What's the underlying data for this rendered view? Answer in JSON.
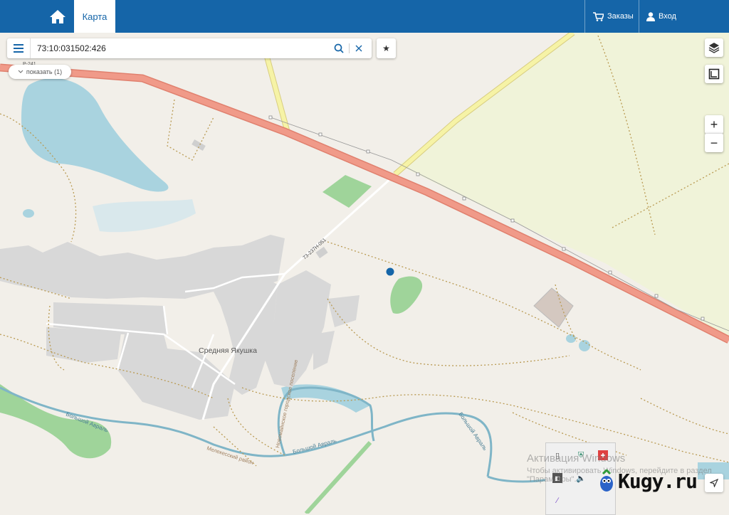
{
  "header": {
    "tab_label": "Карта",
    "orders_label": "Заказы",
    "login_label": "Вход"
  },
  "search": {
    "value": "73:10:031502:426"
  },
  "filter_chip": {
    "label": "показать (1)"
  },
  "map": {
    "settlement_label": "Средняя Якушка",
    "road_label_main": "Р-241",
    "road_label_local": "73-237Н-051",
    "river_label_1": "Большой Авраль",
    "river_label_2": "Большой Авраль",
    "river_label_3": "Большой Авраль",
    "district_label": "Мелекесский район",
    "settlement_boundary_label": "Новомайнское городское поселение",
    "colors": {
      "background": "#f2efe9",
      "motorway": "#f09a89",
      "secondary_road": "#f6f3a6",
      "water": "#a9d3df",
      "field": "#f0f3d9",
      "forest": "#9fd49a",
      "industrial": "#d8d8d8",
      "boundary": "#b99a52",
      "marker": "#1565a8"
    }
  },
  "controls": {
    "zoom_in": "+",
    "zoom_out": "−",
    "icons": [
      "layers-icon",
      "ruler-icon",
      "navigate-icon"
    ]
  },
  "overlay": {
    "activation_title": "Активация Windows",
    "activation_text": "Чтобы активировать Windows, перейдите в раздел \"Параметры\".",
    "brand": "Kugy.ru"
  }
}
